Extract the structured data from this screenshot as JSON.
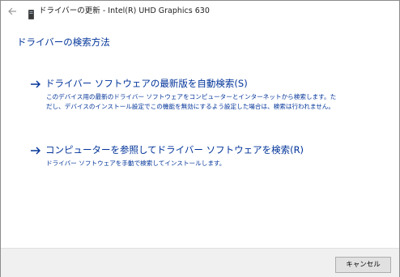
{
  "titlebar": {
    "back_icon": "back-arrow-icon",
    "device_icon": "display-adapter-icon",
    "title": "ドライバーの更新 - Intel(R) UHD Graphics 630"
  },
  "main": {
    "page_title": "ドライバーの検索方法",
    "options": [
      {
        "icon": "right-arrow-icon",
        "title": "ドライバー ソフトウェアの最新版を自動検索(S)",
        "description": "このデバイス用の最新のドライバー ソフトウェアをコンピューターとインターネットから検索します。ただし、デバイスのインストール設定でこの機能を無効にするよう設定した場合は、検索は行われません。"
      },
      {
        "icon": "right-arrow-icon",
        "title": "コンピューターを参照してドライバー ソフトウェアを検索(R)",
        "description": "ドライバー ソフトウェアを手動で検索してインストールします。"
      }
    ]
  },
  "footer": {
    "cancel_label": "キャンセル"
  },
  "colors": {
    "link_blue": "#003399",
    "footer_bg": "#f0f0f0",
    "button_bg": "#e1e1e1"
  }
}
